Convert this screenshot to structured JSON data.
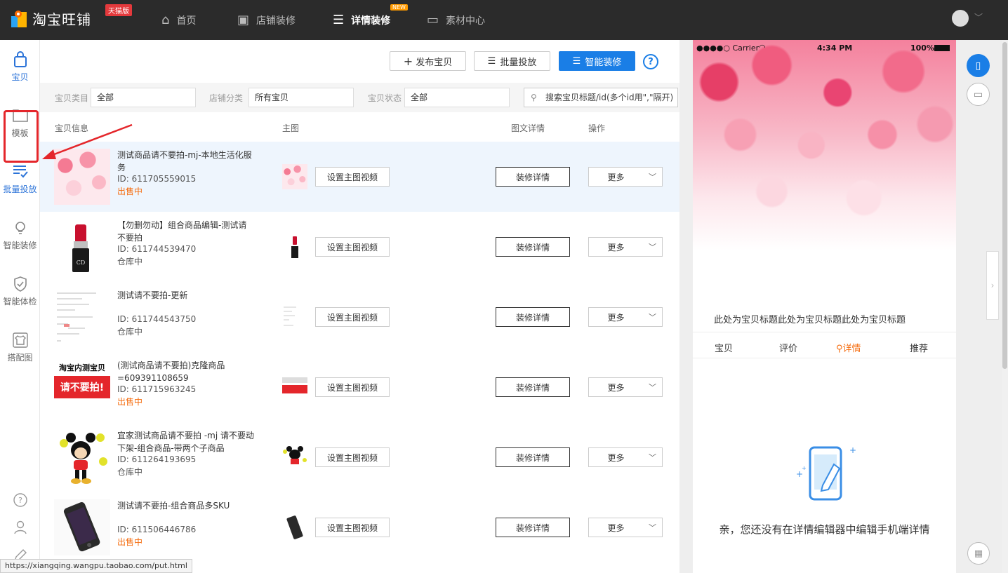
{
  "topbar": {
    "brand": "淘宝旺铺",
    "edition_badge": "天猫版",
    "nav": [
      {
        "label": "首页",
        "icon": "home-icon"
      },
      {
        "label": "店铺装修",
        "icon": "store-icon"
      },
      {
        "label": "详情装修",
        "icon": "document-icon",
        "active": true,
        "badge": "NEW"
      },
      {
        "label": "素材中心",
        "icon": "folder-icon"
      }
    ]
  },
  "sidebar": {
    "items": [
      {
        "label": "宝贝",
        "icon": "bag-icon",
        "active": true
      },
      {
        "label": "模板",
        "icon": "folder-icon"
      },
      {
        "label": "批量投放",
        "icon": "list-check-icon",
        "highlighted": true
      },
      {
        "label": "智能装修",
        "icon": "lightbulb-icon"
      },
      {
        "label": "智能体检",
        "icon": "shield-check-icon"
      },
      {
        "label": "搭配图",
        "icon": "tshirt-icon"
      }
    ]
  },
  "toolbar": {
    "publish": "发布宝贝",
    "batch": "批量投放",
    "smart": "智能装修",
    "help": "?"
  },
  "filters": {
    "category_label": "宝贝类目",
    "category_value": "全部",
    "shop_cat_label": "店铺分类",
    "shop_cat_value": "所有宝贝",
    "status_label": "宝贝状态",
    "status_value": "全部",
    "search_placeholder": "搜索宝贝标题/id(多个id用\",\"隔开)"
  },
  "table": {
    "headers": {
      "info": "宝贝信息",
      "main_image": "主图",
      "detail": "图文详情",
      "action": "操作"
    },
    "set_video_label": "设置主图视频",
    "decorate_label": "装修详情",
    "more_label": "更多",
    "rows": [
      {
        "title": "测试商品请不要拍-mj-本地生活化服务",
        "id": "ID: 611705559015",
        "status": "出售中",
        "onsale": true,
        "thumb": "petals"
      },
      {
        "title": "【勿删勿动】组合商品编辑-测试请不要拍",
        "id": "ID: 611744539470",
        "status": "仓库中",
        "onsale": false,
        "thumb": "lipstick"
      },
      {
        "title": "测试请不要拍-更新",
        "id": "ID: 611744543750",
        "status": "仓库中",
        "onsale": false,
        "thumb": "doc"
      },
      {
        "title": "(测试商品请不要拍)克隆商品=609391108659",
        "id": "ID: 611715963245",
        "status": "出售中",
        "onsale": true,
        "thumb": "redtext"
      },
      {
        "title": "宜家测试商品请不要拍 -mj 请不要动下架-组合商品-带两个子商品",
        "id": "ID: 611264193695",
        "status": "仓库中",
        "onsale": false,
        "thumb": "mickey"
      },
      {
        "title": "测试请不要拍-组合商品多SKU",
        "id": "ID: 611506446786",
        "status": "出售中",
        "onsale": true,
        "thumb": "phone"
      }
    ],
    "redtext_thumb": {
      "top": "淘宝内测宝贝",
      "main": "请不要拍!"
    }
  },
  "preview": {
    "status_carrier": "●●●●○ Carrier",
    "status_time": "4:34 PM",
    "status_battery": "100%",
    "product_title": "此处为宝贝标题此处为宝贝标题此处为宝贝标题",
    "tabs": [
      "宝贝",
      "评价",
      "详情",
      "推荐"
    ],
    "active_tab": "详情",
    "empty_text": "亲，您还没有在详情编辑器中编辑手机端详情"
  },
  "status_url": "https://xiangqing.wangpu.taobao.com/put.html"
}
